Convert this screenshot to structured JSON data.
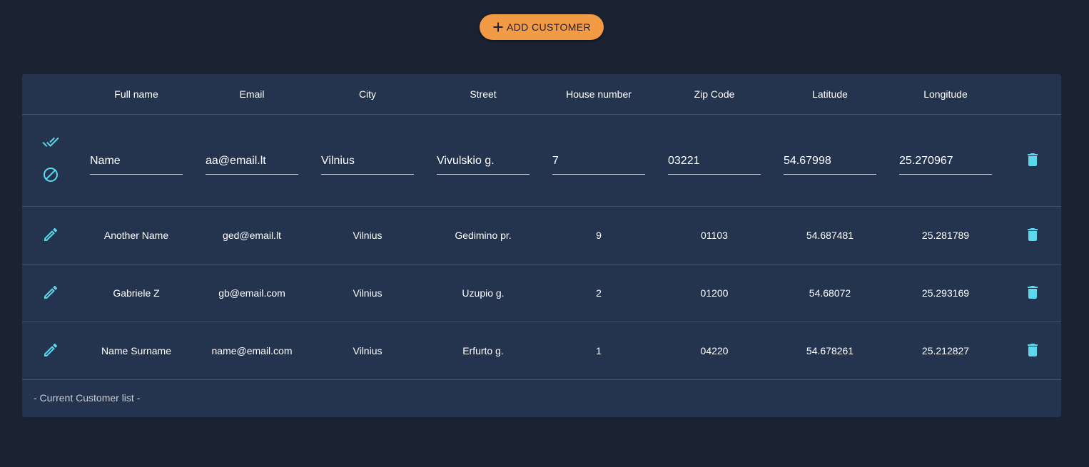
{
  "add_button": {
    "label": "ADD CUSTOMER",
    "icon": "plus-icon"
  },
  "columns": [
    "Full name",
    "Email",
    "City",
    "Street",
    "House number",
    "Zip Code",
    "Latitude",
    "Longitude"
  ],
  "edit_row": {
    "values": [
      "Name",
      "aa@email.lt",
      "Vilnius",
      "Vivulskio g.",
      "7",
      "03221",
      "54.67998",
      "25.270967"
    ],
    "actions": [
      "done-all-icon",
      "cancel-icon"
    ],
    "delete_icon": "delete-icon"
  },
  "rows": [
    [
      "Another Name",
      "ged@email.lt",
      "Vilnius",
      "Gedimino pr.",
      "9",
      "01103",
      "54.687481",
      "25.281789"
    ],
    [
      "Gabriele Z",
      "gb@email.com",
      "Vilnius",
      "Uzupio g.",
      "2",
      "01200",
      "54.68072",
      "25.293169"
    ],
    [
      "Name Surname",
      "name@email.com",
      "Vilnius",
      "Erfurto g.",
      "1",
      "04220",
      "54.678261",
      "25.212827"
    ]
  ],
  "row_icons": {
    "edit": "pencil-icon",
    "delete": "delete-icon"
  },
  "footer": {
    "text": "- Current Customer list -"
  },
  "colors": {
    "background": "#1b2333",
    "card": "#24344e",
    "accent": "#f39a45",
    "icon": "#5ad8ee"
  }
}
